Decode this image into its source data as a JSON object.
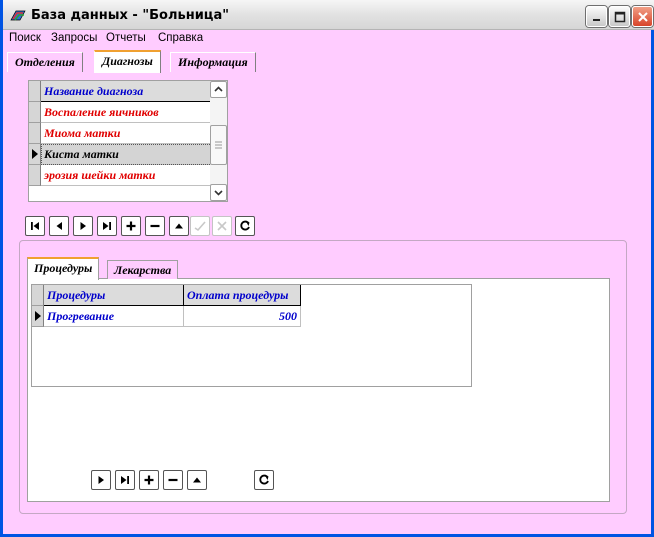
{
  "window": {
    "title": "База данных - \"Больница\""
  },
  "menu": [
    "Поиск",
    "Запросы",
    "Отчеты",
    "Справка"
  ],
  "main_tabs": [
    {
      "label": "Отделения",
      "active": false
    },
    {
      "label": "Диагнозы",
      "active": true
    },
    {
      "label": "Информация",
      "active": false
    }
  ],
  "diagnoses": {
    "header": "Название диагноза",
    "rows": [
      {
        "name": "Воспаление яичников",
        "selected": false
      },
      {
        "name": "Миома матки",
        "selected": false
      },
      {
        "name": "Киста матки",
        "selected": true
      },
      {
        "name": "эрозия шейки матки",
        "selected": false
      }
    ]
  },
  "sub_tabs": [
    {
      "label": "Процедуры",
      "active": true
    },
    {
      "label": "Лекарства",
      "active": false
    }
  ],
  "procedures": {
    "headers": [
      "Процедуры",
      "Оплата процедуры"
    ],
    "rows": [
      {
        "name": "Прогревание",
        "price": "500"
      }
    ]
  },
  "icons": {
    "nav_main": [
      "first-icon",
      "prior-icon",
      "next-icon",
      "last-icon",
      "insert-icon",
      "delete-icon",
      "edit-icon",
      "post-icon",
      "cancel-icon",
      "refresh-icon"
    ],
    "nav_sub": [
      "next-icon",
      "last-icon",
      "insert-icon",
      "delete-icon",
      "edit-icon",
      "refresh-icon"
    ]
  },
  "colors": {
    "background": "#ffccff",
    "header_text": "#0000cc",
    "diagnosis_text": "#e00000"
  }
}
